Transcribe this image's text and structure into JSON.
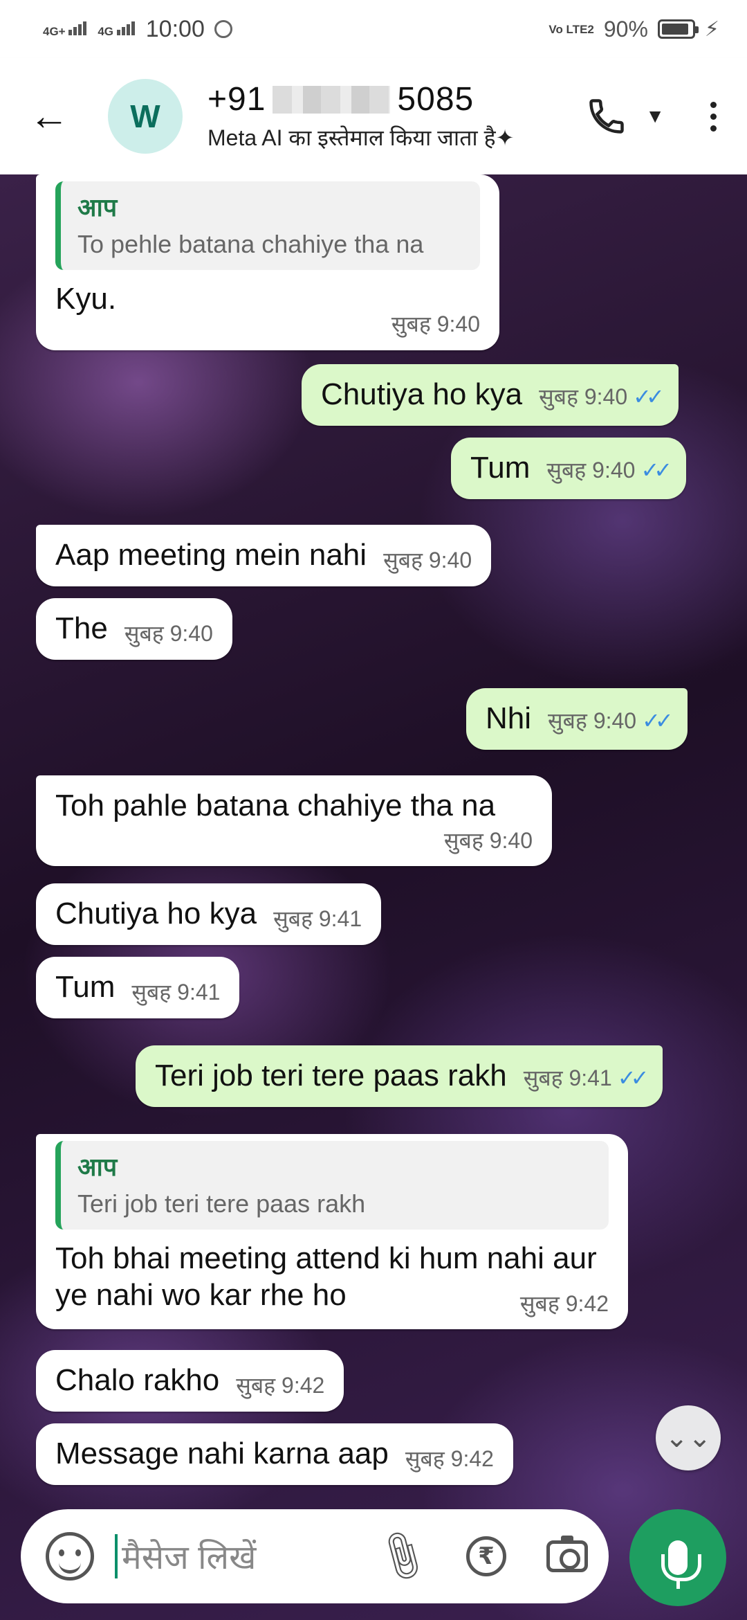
{
  "status_bar": {
    "network1": "4G+",
    "network2": "4G",
    "time": "10:00",
    "volte": "Vo LTE2",
    "battery": "90%",
    "battery_level": 0.9
  },
  "header": {
    "avatar_letter": "W",
    "contact_prefix": "+91",
    "contact_suffix": "5085",
    "subtitle": "Meta AI का इस्तेमाल किया जाता है✦"
  },
  "messages": [
    {
      "dir": "in",
      "quote_author": "आप",
      "quote_text": "To pehle  batana chahiye tha na",
      "text": "Kyu.",
      "time": "सुबह 9:40"
    },
    {
      "dir": "out",
      "text": "Chutiya ho kya",
      "time": "सुबह 9:40",
      "ticks": "✓✓"
    },
    {
      "dir": "out",
      "text": "Tum",
      "time": "सुबह 9:40",
      "ticks": "✓✓"
    },
    {
      "dir": "in",
      "text": "Aap meeting mein nahi",
      "time": "सुबह 9:40"
    },
    {
      "dir": "in",
      "text": "The",
      "time": "सुबह 9:40"
    },
    {
      "dir": "out",
      "text": "Nhi",
      "time": "सुबह 9:40",
      "ticks": "✓✓"
    },
    {
      "dir": "in",
      "text": "Toh pahle batana chahiye tha na",
      "time": "सुबह 9:40"
    },
    {
      "dir": "in",
      "text": "Chutiya ho kya",
      "time": "सुबह 9:41"
    },
    {
      "dir": "in",
      "text": "Tum",
      "time": "सुबह 9:41"
    },
    {
      "dir": "out",
      "text": "Teri job teri tere paas rakh",
      "time": "सुबह 9:41",
      "ticks": "✓✓"
    },
    {
      "dir": "in",
      "quote_author": "आप",
      "quote_text": "Teri job teri tere paas rakh",
      "text": "Toh bhai meeting attend ki hum nahi aur ye nahi wo kar rhe ho",
      "time": "सुबह 9:42"
    },
    {
      "dir": "in",
      "text": "Chalo rakho",
      "time": "सुबह 9:42"
    },
    {
      "dir": "in",
      "text": "Message nahi karna aap",
      "time": "सुबह 9:42"
    }
  ],
  "composer": {
    "placeholder": "मैसेज लिखें",
    "rupee_symbol": "₹"
  },
  "scroll_button": "⌄⌄",
  "colors": {
    "incoming": "#ffffff",
    "outgoing": "#dbf8c9",
    "accent": "#1e9e60",
    "tick": "#3b8ce0"
  }
}
